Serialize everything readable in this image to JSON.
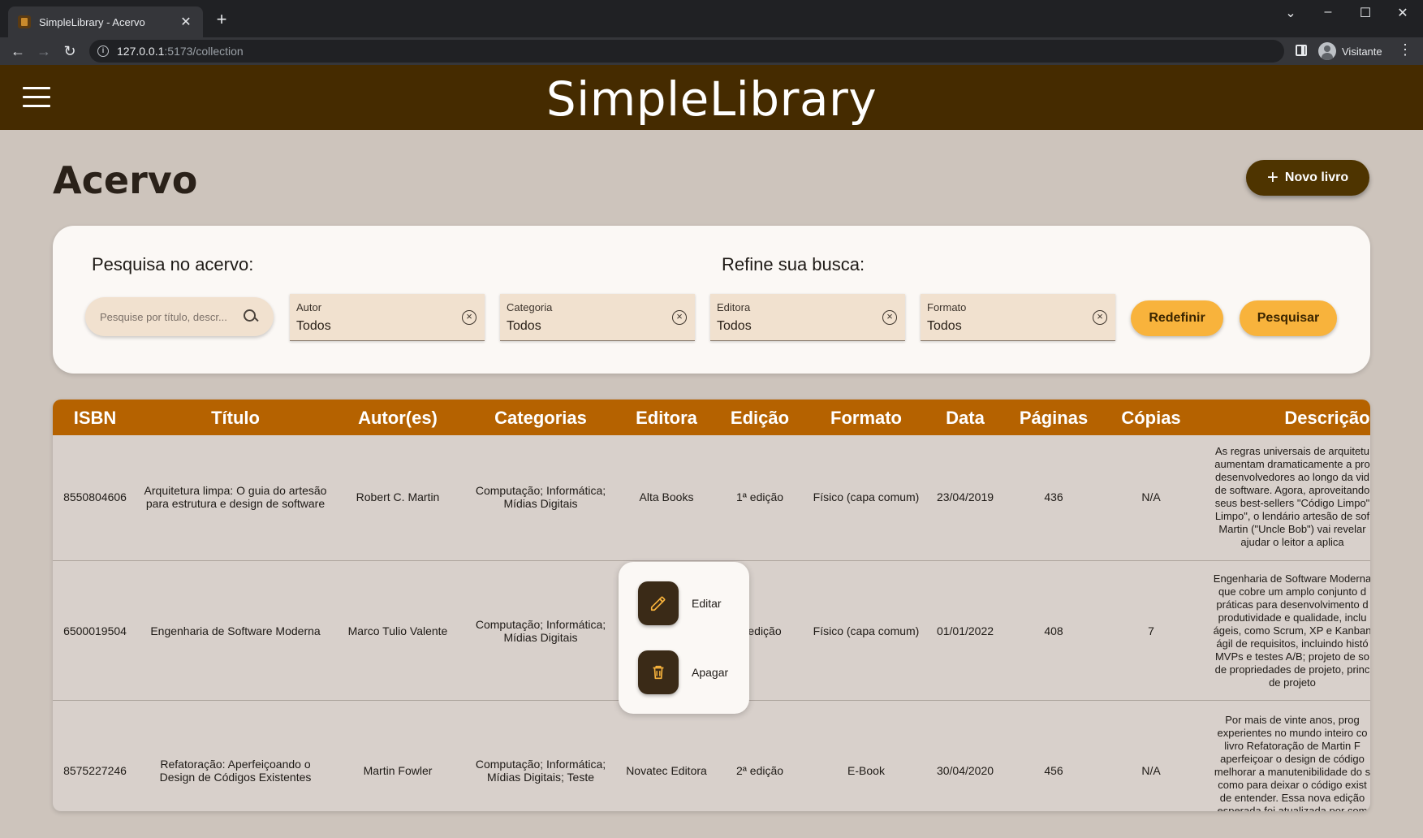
{
  "browser": {
    "tab_title": "SimpleLibrary - Acervo",
    "url_host": "127.0.0.1",
    "url_path": ":5173/collection",
    "profile_name": "Visitante"
  },
  "app": {
    "title": "SimpleLibrary"
  },
  "page": {
    "title": "Acervo",
    "new_book_label": "Novo livro"
  },
  "search": {
    "heading": "Pesquisa no acervo:",
    "refine_heading": "Refine sua busca:",
    "placeholder": "Pesquise por título, descr...",
    "filters": [
      {
        "label": "Autor",
        "value": "Todos"
      },
      {
        "label": "Categoria",
        "value": "Todos"
      },
      {
        "label": "Editora",
        "value": "Todos"
      },
      {
        "label": "Formato",
        "value": "Todos"
      }
    ],
    "reset_label": "Redefinir",
    "submit_label": "Pesquisar"
  },
  "table": {
    "columns": [
      "ISBN",
      "Título",
      "Autor(es)",
      "Categorias",
      "Editora",
      "Edição",
      "Formato",
      "Data",
      "Páginas",
      "Cópias",
      "Descrição"
    ],
    "rows": [
      {
        "isbn": "8550804606",
        "title_l1": "Arquitetura limpa: O guia do artesão",
        "title_l2": "para estrutura e design de software",
        "author": "Robert C. Martin",
        "cat_l1": "Computação; Informática;",
        "cat_l2": "Mídias Digitais",
        "publisher": "Alta Books",
        "edition": "1ª edição",
        "format": "Físico (capa comum)",
        "date": "23/04/2019",
        "pages": "436",
        "copies": "N/A",
        "desc": [
          "As regras universais de arquitetu",
          "aumentam dramaticamente a pro",
          "desenvolvedores ao longo da vid",
          "de software. Agora, aproveitando",
          "seus best-sellers \"Código Limpo\"",
          "Limpo\", o lendário artesão de sof",
          "Martin (\"Uncle Bob\") vai revelar",
          "ajudar o leitor a aplica"
        ]
      },
      {
        "isbn": "6500019504",
        "title_l1": "Engenharia de Software Moderna",
        "title_l2": "",
        "author": "Marco Tulio Valente",
        "cat_l1": "Computação; Informática;",
        "cat_l2": "Mídias Digitais",
        "publisher": "",
        "edition": "edição",
        "format": "Físico (capa comum)",
        "date": "01/01/2022",
        "pages": "408",
        "copies": "7",
        "desc": [
          "Engenharia de Software Moderna",
          "que cobre um amplo conjunto d",
          "práticas para desenvolvimento d",
          "produtividade e qualidade, inclu",
          "ágeis, como Scrum, XP e Kanban",
          "ágil de requisitos, incluindo histó",
          "MVPs e testes A/B; projeto de so",
          "de propriedades de projeto, princ",
          "de projeto"
        ]
      },
      {
        "isbn": "8575227246",
        "title_l1": "Refatoração: Aperfeiçoando o",
        "title_l2": "Design de Códigos Existentes",
        "author": "Martin Fowler",
        "cat_l1": "Computação; Informática;",
        "cat_l2": "Mídias Digitais; Teste",
        "publisher": "Novatec Editora",
        "edition": "2ª edição",
        "format": "E-Book",
        "date": "30/04/2020",
        "pages": "456",
        "copies": "N/A",
        "desc": [
          "Por mais de vinte anos, prog",
          "experientes no mundo inteiro co",
          "livro Refatoração de Martin F",
          "aperfeiçoar o design de código",
          "melhorar a manutenibilidade do s",
          "como para deixar o código exist",
          "de entender. Essa nova edição",
          "esperada foi atualizada por com"
        ]
      }
    ]
  },
  "context_menu": {
    "edit_label": "Editar",
    "delete_label": "Apagar"
  },
  "colors": {
    "header": "#452b00",
    "accent": "#f8b33c",
    "table_header": "#b56200",
    "menu_icon_bg": "#3a2a17"
  }
}
